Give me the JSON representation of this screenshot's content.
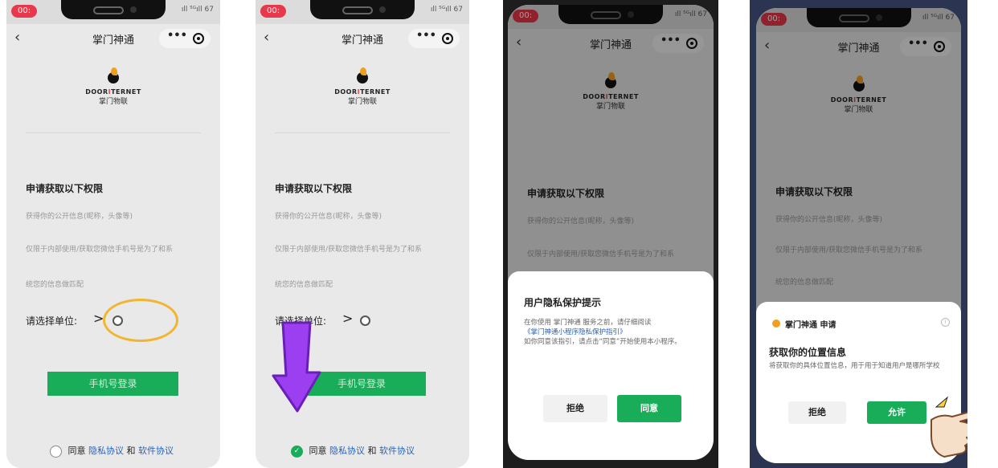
{
  "status": {
    "recording": "00:",
    "signal": "ıll ⁵ᴳıll 67"
  },
  "navbar": {
    "back": "‹",
    "title": "掌门神通",
    "more": "•••"
  },
  "logo": {
    "en_left": "DOOR",
    "en_mid": "I",
    "en_right": "TERNET",
    "cn": "掌门物联"
  },
  "permissions": {
    "title": "申请获取以下权限",
    "line1": "获得你的公开信息(昵称，头像等)",
    "line2": "仅限于内部使用/获取您微信手机号是为了和系",
    "line3": "统您的信息做匹配",
    "unit_label": "请选择单位:",
    "unit_arrow": ">"
  },
  "login": {
    "button": "手机号登录"
  },
  "agreement": {
    "agree": "同意",
    "privacy": "隐私协议",
    "and": "和",
    "software": "软件协议",
    "check": "✓"
  },
  "privacy_dialog": {
    "title": "用户隐私保护提示",
    "line1": "在你使用 掌门神通 服务之前，请仔细阅读",
    "link": "《掌门神通小程序隐私保护指引》",
    "line2": "如你同意该指引，请点击“同意”开始使用本小程序。",
    "reject": "拒绝",
    "accept": "同意"
  },
  "location_dialog": {
    "app": "掌门神通",
    "apply": "申请",
    "info": "i",
    "title": "获取你的位置信息",
    "desc": "将获取你的具体位置信息，用于用于知道用户是哪所学校",
    "reject": "拒绝",
    "allow": "允许"
  },
  "colors": {
    "accent": "#19ad5a",
    "highlight_circle": "#f2b530",
    "arrow": "#9b3ff0",
    "link": "#2a63b8",
    "record": "#e8384b"
  }
}
